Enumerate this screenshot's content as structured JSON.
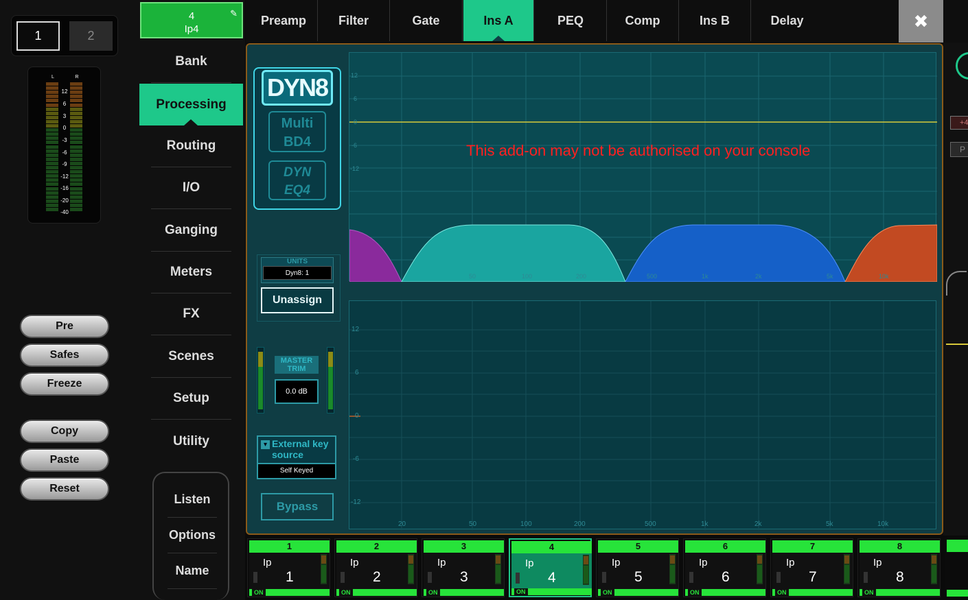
{
  "layers": [
    {
      "label": "1"
    },
    {
      "label": "2"
    }
  ],
  "meter": {
    "left_label": "L",
    "right_label": "R",
    "scale": [
      "12",
      "6",
      "3",
      "0",
      "-3",
      "-6",
      "-9",
      "-12",
      "-16",
      "-20",
      "-40"
    ]
  },
  "left_buttons": {
    "pre": "Pre",
    "safes": "Safes",
    "freeze": "Freeze",
    "copy": "Copy",
    "paste": "Paste",
    "reset": "Reset"
  },
  "channel": {
    "number": "4",
    "name": "Ip4"
  },
  "nav": {
    "items": [
      "Bank",
      "Processing",
      "Routing",
      "I/O",
      "Ganging",
      "Meters",
      "FX",
      "Scenes",
      "Setup",
      "Utility"
    ],
    "active": "Processing"
  },
  "subnav": [
    "Listen",
    "Options",
    "Name"
  ],
  "tabs": {
    "items": [
      "Preamp",
      "Filter",
      "Gate",
      "Ins A",
      "PEQ",
      "Comp",
      "Ins B",
      "Delay"
    ],
    "active": "Ins A"
  },
  "close_symbol": "✖",
  "panel": {
    "plugins": [
      "DYN8",
      "Multi BD4",
      "DYN EQ4"
    ],
    "warning": "This add-on may not be authorised on your console",
    "units": {
      "label": "UNITS",
      "value": "Dyn8: 1"
    },
    "unassign": "Unassign",
    "master_trim": {
      "label": "MASTER TRIM",
      "value": "0.0 dB"
    },
    "external_key": {
      "label": "External key source",
      "value": "Self Keyed"
    },
    "bypass": "Bypass",
    "top_y_labels": [
      "12",
      "6",
      "0",
      "-6",
      "-12"
    ],
    "bottom_y_labels": [
      "12",
      "6",
      "0",
      "-6",
      "-12"
    ],
    "freq_labels": [
      "20",
      "50",
      "100",
      "200",
      "500",
      "1k",
      "2k",
      "5k",
      "10k"
    ],
    "colors": {
      "band1": "#8a2a9c",
      "band2": "#1aa5a0",
      "band3": "#1560c8",
      "band4": "#c24a22",
      "accent": "#1ec88a",
      "warning": "#ff2020"
    }
  },
  "strips": [
    {
      "num": "1",
      "name": "Ip",
      "idx": "1",
      "on": "ON"
    },
    {
      "num": "2",
      "name": "Ip",
      "idx": "2",
      "on": "ON"
    },
    {
      "num": "3",
      "name": "Ip",
      "idx": "3",
      "on": "ON"
    },
    {
      "num": "4",
      "name": "Ip",
      "idx": "4",
      "on": "ON"
    },
    {
      "num": "5",
      "name": "Ip",
      "idx": "5",
      "on": "ON"
    },
    {
      "num": "6",
      "name": "Ip",
      "idx": "6",
      "on": "ON"
    },
    {
      "num": "7",
      "name": "Ip",
      "idx": "7",
      "on": "ON"
    },
    {
      "num": "8",
      "name": "Ip",
      "idx": "8",
      "on": "ON"
    }
  ],
  "right_edge": {
    "gain": "+4",
    "button": "P"
  }
}
